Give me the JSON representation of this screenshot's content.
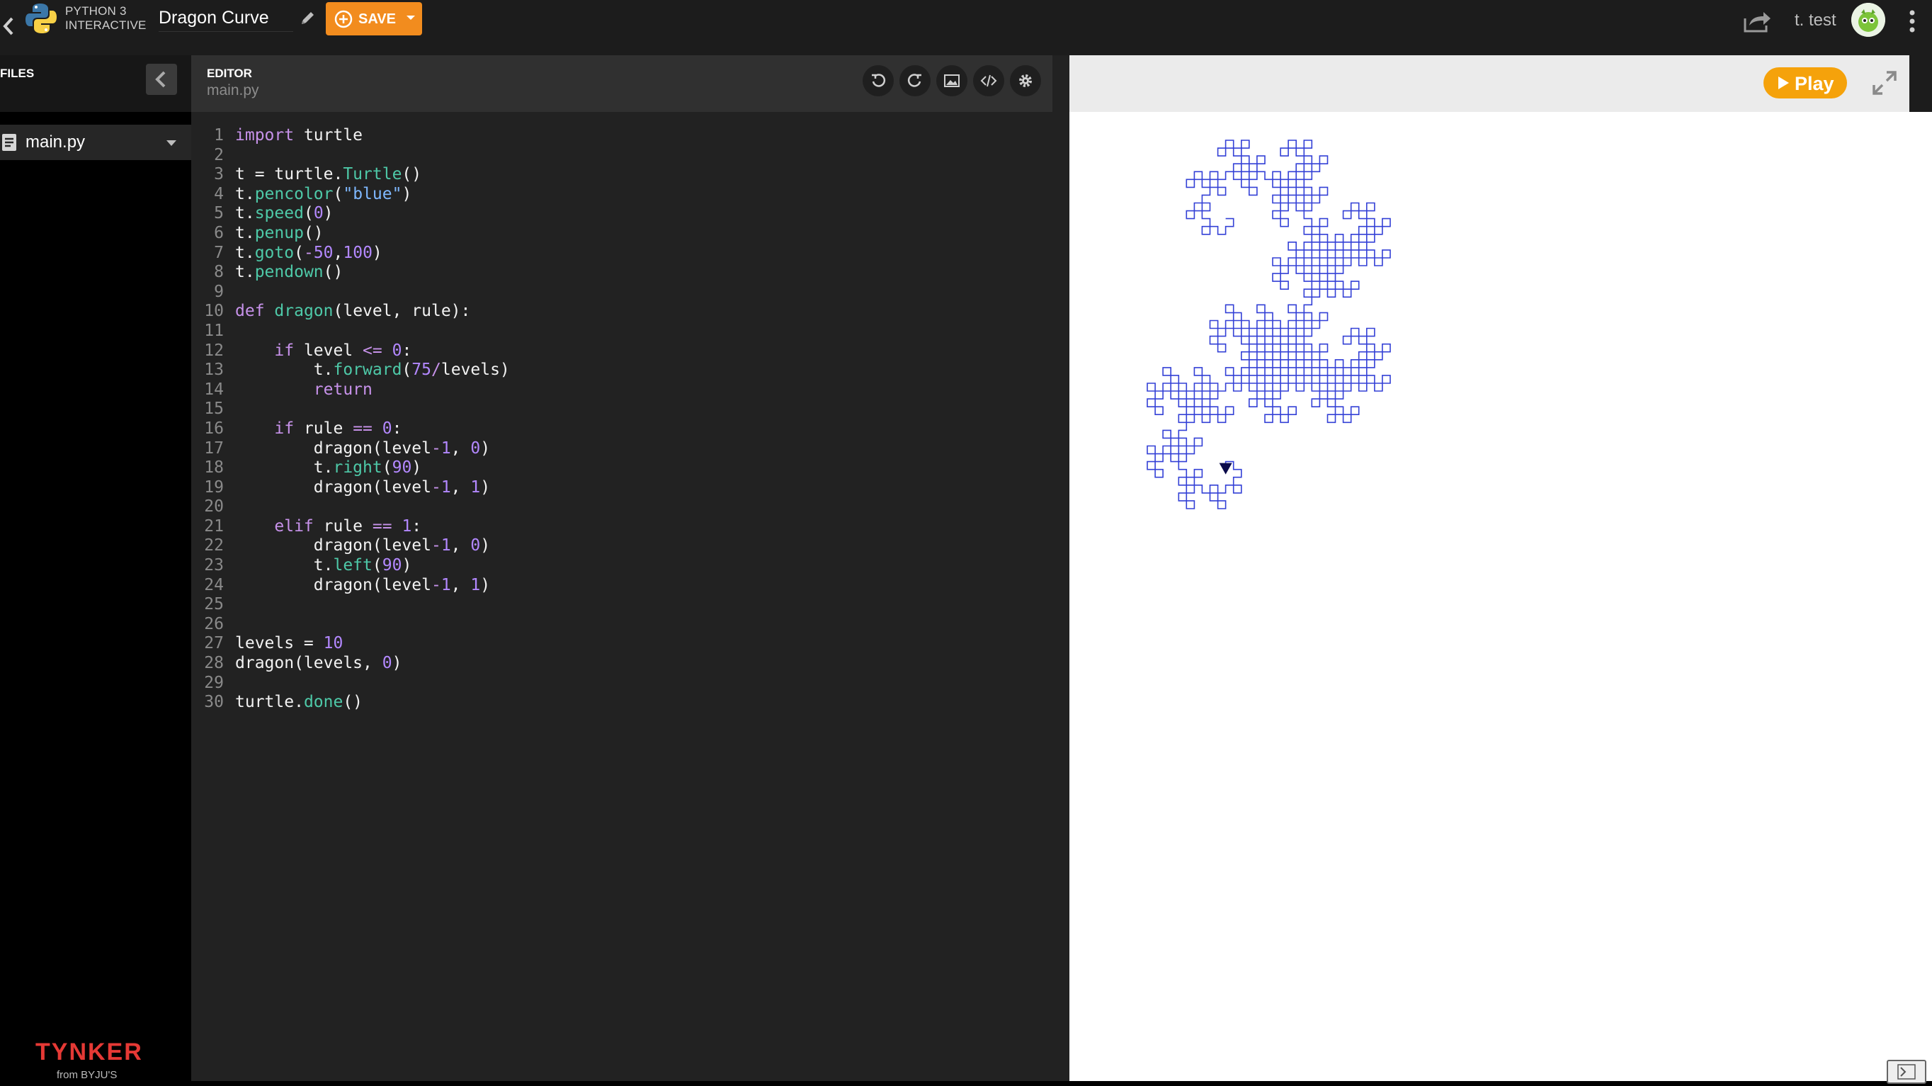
{
  "app": {
    "language_label_line1": "PYTHON 3",
    "language_label_line2": "INTERACTIVE",
    "project_title": "Dragon Curve",
    "save_label": "SAVE",
    "user_name": "t. test"
  },
  "files": {
    "title": "FILES",
    "items": [
      {
        "name": "main.py"
      }
    ],
    "brand_name": "TYNKER",
    "brand_sub": "from BYJU'S"
  },
  "editor": {
    "title": "EDITOR",
    "file": "main.py",
    "tools": [
      "undo-icon",
      "redo-icon",
      "image-icon",
      "code-icon",
      "gear-icon"
    ],
    "lines": [
      "import turtle",
      "",
      "t = turtle.Turtle()",
      "t.pencolor(\"blue\")",
      "t.speed(0)",
      "t.penup()",
      "t.goto(-50,100)",
      "t.pendown()",
      "",
      "def dragon(level, rule):",
      "",
      "    if level <= 0:",
      "        t.forward(75/levels)",
      "        return",
      "",
      "    if rule == 0:",
      "        dragon(level-1, 0)",
      "        t.right(90)",
      "        dragon(level-1, 1)",
      "",
      "    elif rule == 1:",
      "        dragon(level-1, 0)",
      "        t.left(90)",
      "        dragon(level-1, 1)",
      "",
      "",
      "levels = 10",
      "dragon(levels, 0)",
      "",
      "turtle.done()"
    ]
  },
  "output": {
    "play_label": "Play",
    "pen_color": "#3340d6",
    "turtle_color": "#0a0a4a",
    "dragon_levels": 10
  },
  "colors": {
    "save": "#f28c1e",
    "play": "#f5a20b"
  }
}
